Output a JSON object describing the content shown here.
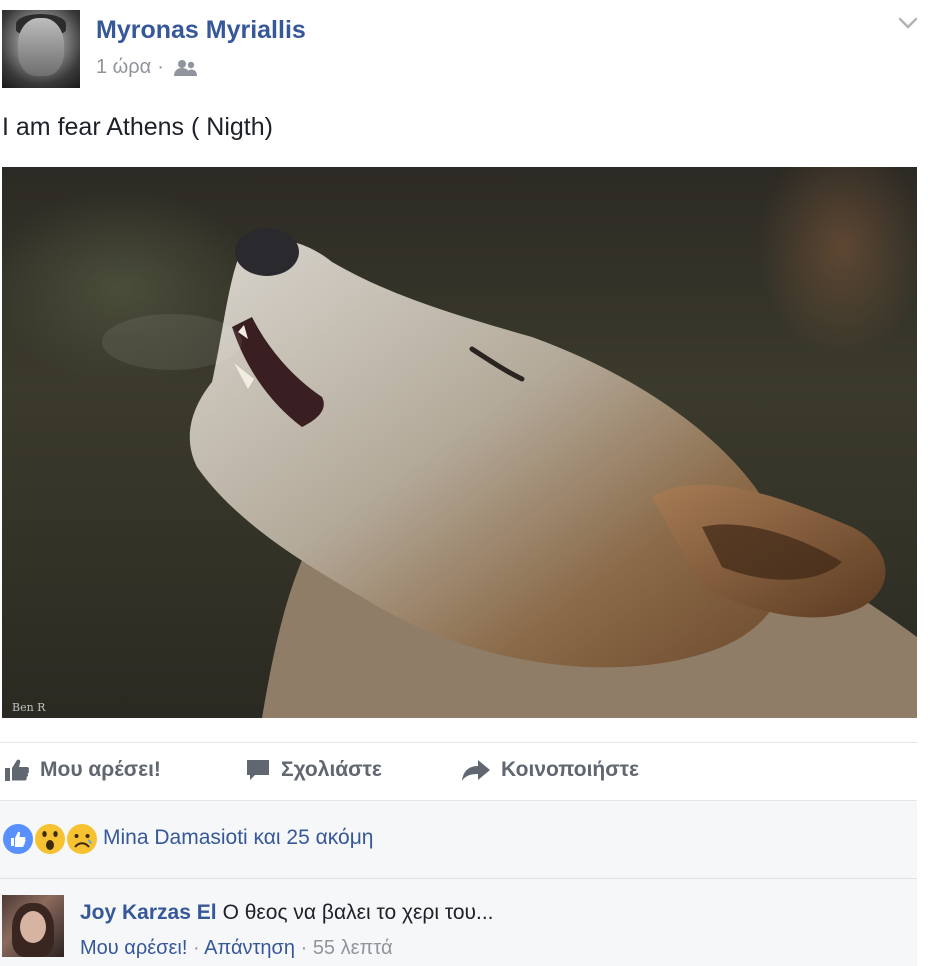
{
  "post": {
    "author": "Myronas Myriallis",
    "time": "1 ώρα",
    "separator": "·",
    "text": "I am fear Athens ( Nigth)",
    "photo_watermark": "Ben R"
  },
  "actions": {
    "like": "Μου αρέσει!",
    "comment": "Σχολιάστε",
    "share": "Κοινοποιήστε"
  },
  "reactions": {
    "text": "Mina Damasioti και 25 ακόμη",
    "icons": [
      "like-reaction",
      "wow-reaction",
      "sad-reaction"
    ]
  },
  "comment": {
    "author": "Joy Karzas El",
    "text": "Ο θεος να βαλει το χερι του...",
    "like_label": "Μου αρέσει!",
    "separator": "·",
    "reply_label": "Απάντηση",
    "time": "55 λεπτά"
  },
  "colors": {
    "link": "#365899",
    "meta": "#90949c",
    "action": "#616770",
    "like_blue": "#5890ff",
    "emoji_yellow": "#f7c232"
  }
}
